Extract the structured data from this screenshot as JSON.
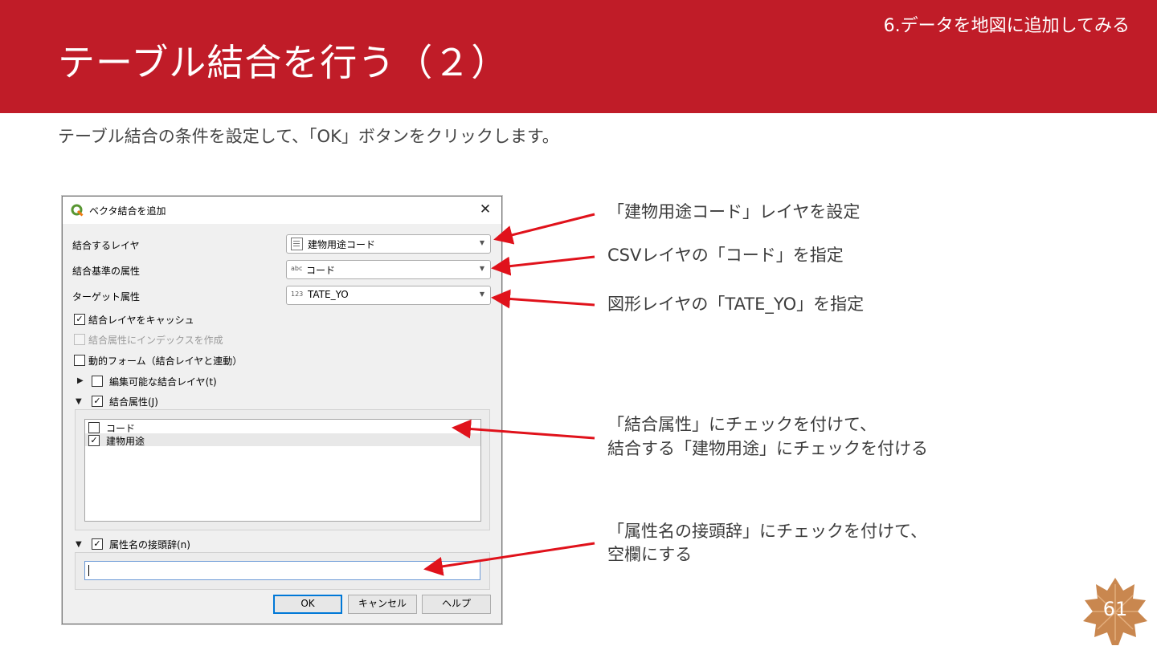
{
  "header": {
    "title": "テーブル結合を行う（２）",
    "section": "6.データを地図に追加してみる"
  },
  "instruction": "テーブル結合の条件を設定して、「OK」ボタンをクリックします。",
  "dialog": {
    "title": "ベクタ結合を追加",
    "join_layer": {
      "label": "結合するレイヤ",
      "value": "建物用途コード",
      "icon": "table-icon"
    },
    "join_field": {
      "label": "結合基準の属性",
      "value": "コード",
      "icon": "abc"
    },
    "target_field": {
      "label": "ターゲット属性",
      "value": "TATE_YO",
      "icon": "123"
    },
    "cache_layer": {
      "label": "結合レイヤをキャッシュ",
      "checked": true
    },
    "create_index": {
      "label": "結合属性にインデックスを作成",
      "checked": false,
      "disabled": true
    },
    "dynamic_form": {
      "label": "動的フォーム（結合レイヤと連動）",
      "checked": false
    },
    "editable_join": {
      "label": "編集可能な結合レイヤ(t)",
      "checked": false,
      "expanded": false
    },
    "joined_fields": {
      "label": "結合属性(J)",
      "checked": true,
      "expanded": true,
      "items": [
        {
          "label": "コード",
          "checked": false
        },
        {
          "label": "建物用途",
          "checked": true
        }
      ]
    },
    "prefix": {
      "label": "属性名の接頭辞(n)",
      "checked": true,
      "expanded": true,
      "value": ""
    },
    "buttons": {
      "ok": "OK",
      "cancel": "キャンセル",
      "help": "ヘルプ"
    }
  },
  "annotations": [
    "「建物用途コード」レイヤを設定",
    "CSVレイヤの「コード」を指定",
    "図形レイヤの「TATE_YO」を指定",
    "「結合属性」にチェックを付けて、",
    "結合する「建物用途」にチェックを付ける",
    "「属性名の接頭辞」にチェックを付けて、",
    "空欄にする"
  ],
  "page_number": "61",
  "colors": {
    "header": "#c01c28",
    "arrow": "#e0121b",
    "badge": "#c9874f"
  }
}
